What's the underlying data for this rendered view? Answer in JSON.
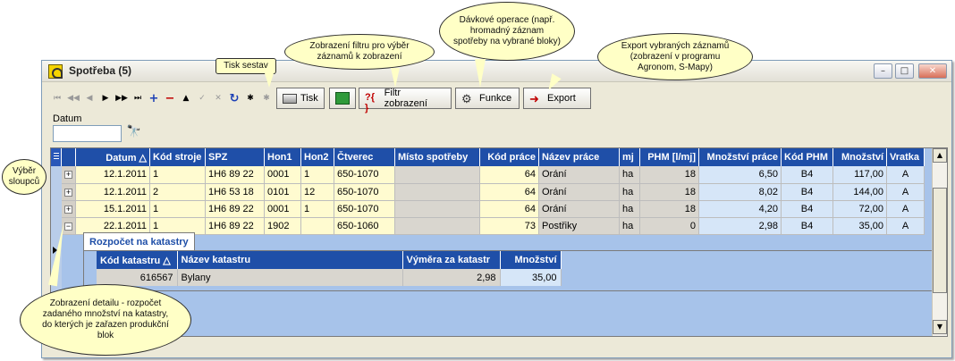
{
  "window": {
    "title": "Spotřeba (5)",
    "buttons": {
      "minimize": "–",
      "maximize": "□",
      "close": "✕"
    }
  },
  "toolbar": {
    "nav_glyphs": [
      "⏮",
      "◀◀",
      "◀",
      "▶",
      "▶▶",
      "⏭",
      "+",
      "−",
      "▲",
      "✓",
      "✕",
      "↻",
      "✱",
      "✱"
    ],
    "print_label": "Tisk",
    "filter_label": "Filtr zobrazení",
    "functions_label": "Funkce",
    "export_label": "Export"
  },
  "filter": {
    "label": "Datum",
    "value": ""
  },
  "grid": {
    "columns": [
      "Datum",
      "Kód stroje",
      "SPZ",
      "Hon1",
      "Hon2",
      "Čtverec",
      "Místo spotřeby",
      "Kód práce",
      "Název práce",
      "mj",
      "PHM [l/mj]",
      "Množství práce",
      "Kód PHM",
      "Množství",
      "Vratka"
    ],
    "rows": [
      [
        "12.1.2011",
        "1",
        "1H6 89 22",
        "0001",
        "1",
        "650-1070",
        "",
        "64",
        "Orání",
        "ha",
        "18",
        "6,50",
        "B4",
        "117,00",
        "A"
      ],
      [
        "12.1.2011",
        "2",
        "1H6 53 18",
        "0101",
        "12",
        "650-1070",
        "",
        "64",
        "Orání",
        "ha",
        "18",
        "8,02",
        "B4",
        "144,00",
        "A"
      ],
      [
        "15.1.2011",
        "1",
        "1H6 89 22",
        "0001",
        "1",
        "650-1070",
        "",
        "64",
        "Orání",
        "ha",
        "18",
        "4,20",
        "B4",
        "72,00",
        "A"
      ],
      [
        "22.1.2011",
        "1",
        "1H6 89 22",
        "1902",
        "",
        "650-1060",
        "",
        "73",
        "Postřiky",
        "ha",
        "0",
        "2,98",
        "B4",
        "35,00",
        "A"
      ]
    ],
    "expanders": [
      "+",
      "+",
      "+",
      "−"
    ]
  },
  "detail": {
    "tab": "Rozpočet na katastry",
    "columns": [
      "Kód katastru",
      "Název katastru",
      "Výměra za katastr",
      "Množství"
    ],
    "rows": [
      [
        "616567",
        "Bylany",
        "2,98",
        "35,00"
      ]
    ]
  },
  "callouts": {
    "print": "Tisk sestav",
    "filter": "Zobrazení filtru pro výběr záznamů k zobrazení",
    "batch": "Dávkové operace (např. hromadný záznam spotřeby na vybrané bloky)",
    "export": "Export vybraných záznamů (zobrazení v programu Agronom, S-Mapy)",
    "columns": "Výběr sloupců",
    "detail": "Zobrazení detailu - rozpočet zadaného množství na katastry, do kterých je zařazen produkční blok"
  }
}
